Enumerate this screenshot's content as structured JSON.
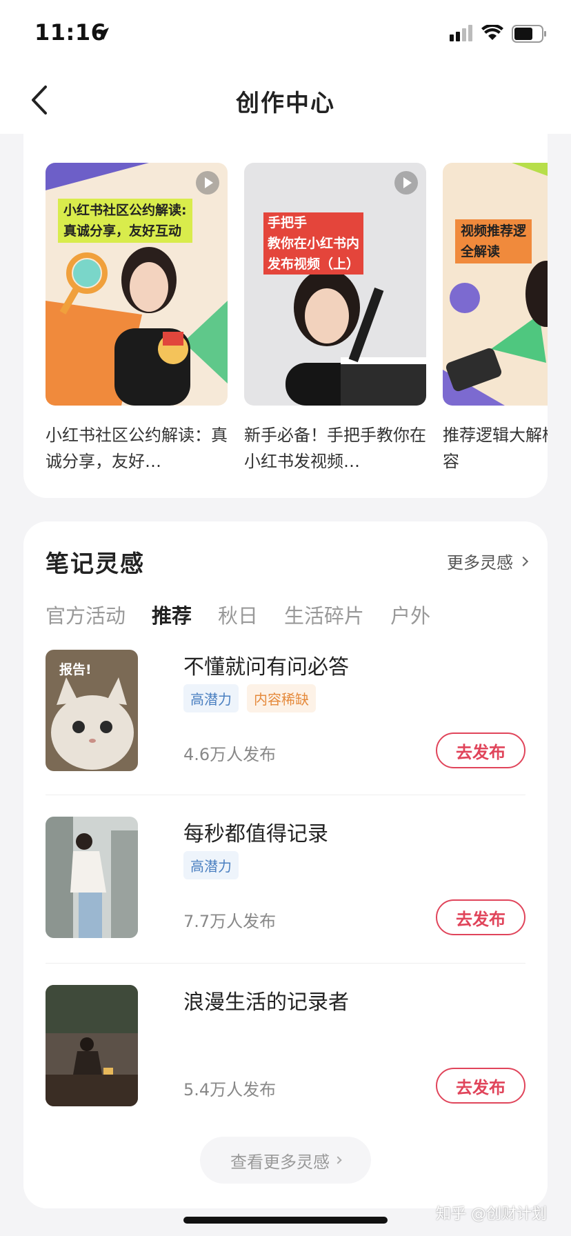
{
  "status": {
    "time": "11:16"
  },
  "nav": {
    "title": "创作中心"
  },
  "videos": [
    {
      "thumb_text": [
        "小红书社区公约解读:",
        "真诚分享，友好互动"
      ],
      "title": "小红书社区公约解读：真诚分享，友好…"
    },
    {
      "thumb_text": [
        "手把手",
        "教你在小红书内",
        "发布视频（上）"
      ],
      "title": "新手必备！手把手教你在小红书发视频…"
    },
    {
      "thumb_text": [
        "视频推荐逻",
        "全解读"
      ],
      "title": "推荐逻辑大解样的视频更容"
    }
  ],
  "inspiration": {
    "title": "笔记灵感",
    "more": "更多灵感",
    "tabs": [
      "官方活动",
      "推荐",
      "秋日",
      "生活碎片",
      "户外"
    ],
    "active_tab": "推荐",
    "topics": [
      {
        "name": "不懂就问有问必答",
        "tags": [
          {
            "label": "高潜力",
            "color": "blue"
          },
          {
            "label": "内容稀缺",
            "color": "orange"
          }
        ],
        "count": "4.6万人发布",
        "thumb_label": "报告!",
        "button": "去发布"
      },
      {
        "name": "每秒都值得记录",
        "tags": [
          {
            "label": "高潜力",
            "color": "blue"
          }
        ],
        "count": "7.7万人发布",
        "button": "去发布"
      },
      {
        "name": "浪漫生活的记录者",
        "tags": [],
        "count": "5.4万人发布",
        "button": "去发布"
      }
    ],
    "see_more": "查看更多灵感"
  },
  "watermark": "知乎 @创财计划",
  "colors": {
    "accent": "#e0445a",
    "tag_blue": "#4a7fc0",
    "tag_orange": "#e58a3c"
  }
}
